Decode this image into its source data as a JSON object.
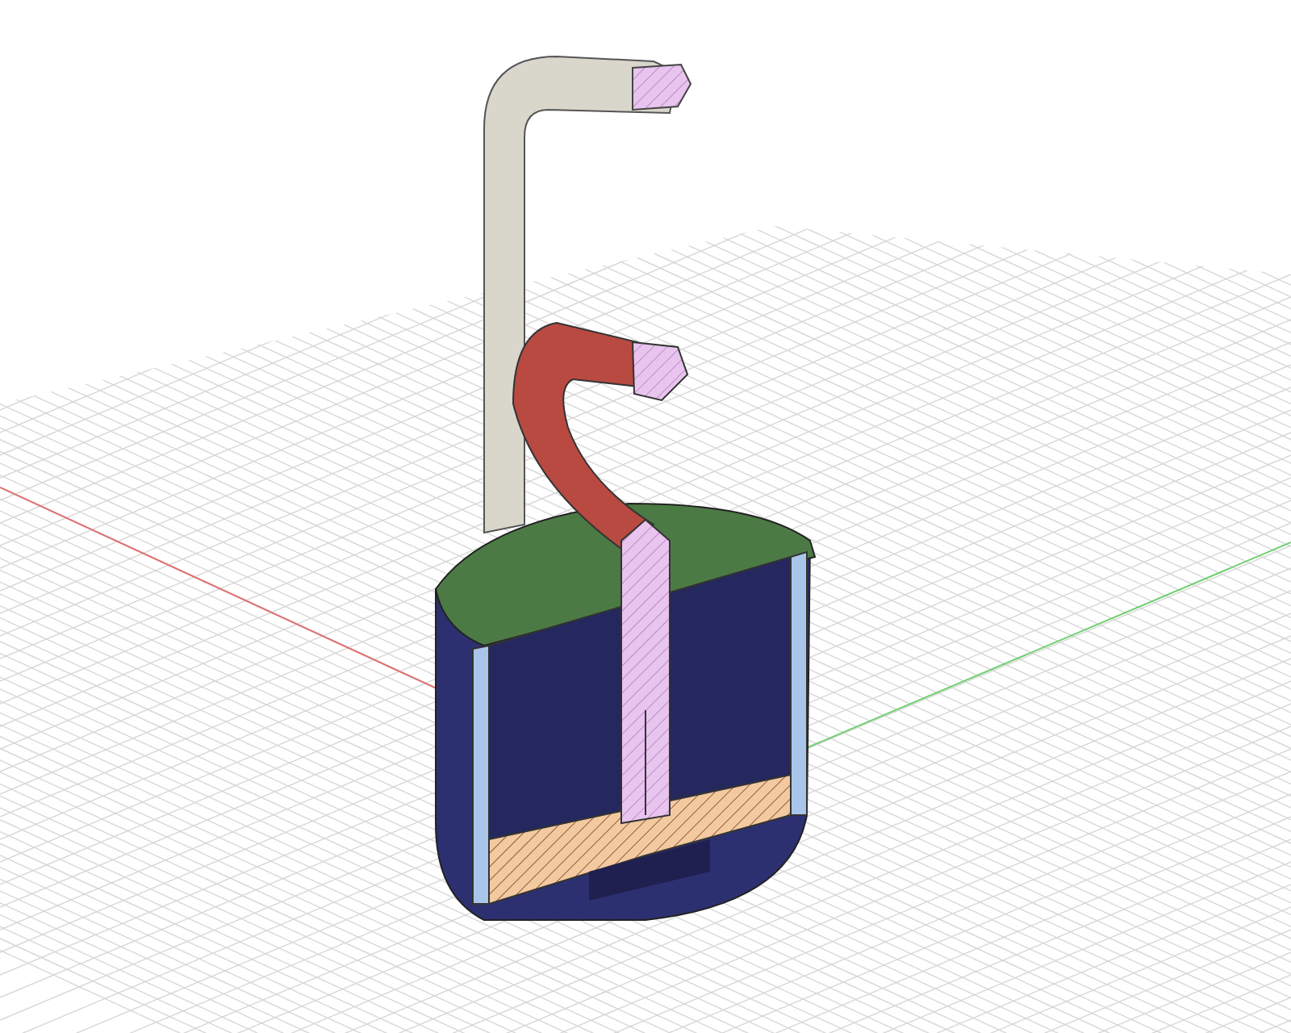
{
  "scene": {
    "kind": "section",
    "show_grid": true,
    "show_axes": true
  }
}
